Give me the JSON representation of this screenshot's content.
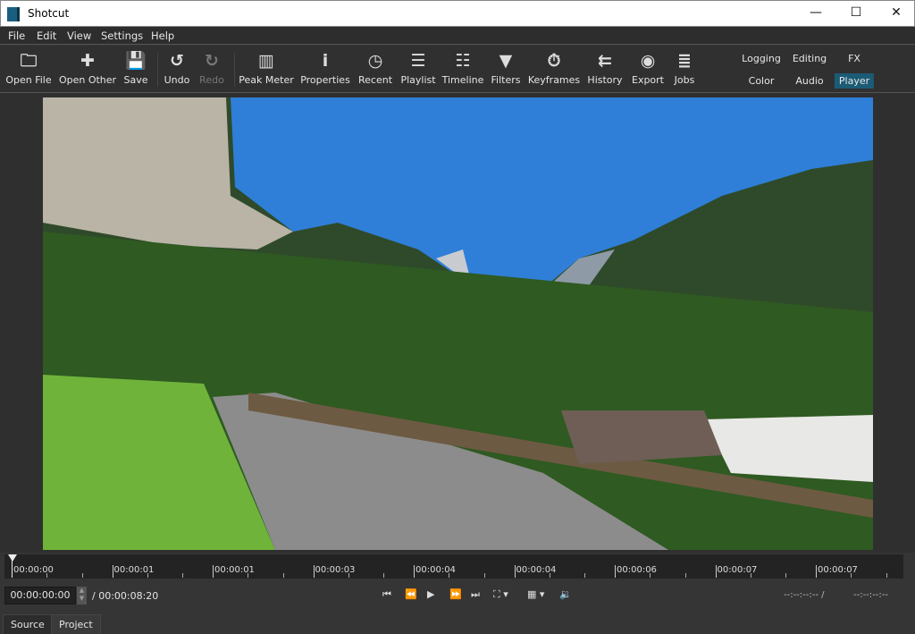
{
  "window": {
    "title": "Shotcut",
    "minimize": "—",
    "maximize": "☐",
    "close": "✕"
  },
  "menu": [
    "File",
    "Edit",
    "View",
    "Settings",
    "Help"
  ],
  "toolbar": [
    {
      "label": "Open File",
      "icon": "folder-icon",
      "glyph": "🗀"
    },
    {
      "label": "Open Other",
      "icon": "add-file-icon",
      "glyph": "✚"
    },
    {
      "label": "Save",
      "icon": "save-icon",
      "glyph": "💾"
    },
    {
      "label": "Undo",
      "icon": "undo-icon",
      "glyph": "↺"
    },
    {
      "label": "Redo",
      "icon": "redo-icon",
      "glyph": "↻",
      "disabled": true
    },
    {
      "label": "Peak Meter",
      "icon": "peak-meter-icon",
      "glyph": "▥"
    },
    {
      "label": "Properties",
      "icon": "info-icon",
      "glyph": "i"
    },
    {
      "label": "Recent",
      "icon": "clock-icon",
      "glyph": "◷"
    },
    {
      "label": "Playlist",
      "icon": "list-icon",
      "glyph": "☰"
    },
    {
      "label": "Timeline",
      "icon": "timeline-icon",
      "glyph": "☷"
    },
    {
      "label": "Filters",
      "icon": "filter-icon",
      "glyph": "▼"
    },
    {
      "label": "Keyframes",
      "icon": "stopwatch-icon",
      "glyph": "⏱"
    },
    {
      "label": "History",
      "icon": "history-icon",
      "glyph": "⇇"
    },
    {
      "label": "Export",
      "icon": "disc-icon",
      "glyph": "◉"
    },
    {
      "label": "Jobs",
      "icon": "database-icon",
      "glyph": "≣"
    }
  ],
  "layouts": {
    "row1": [
      "Logging",
      "Editing",
      "FX"
    ],
    "row2": [
      "Color",
      "Audio",
      "Player"
    ],
    "active": "Player",
    "active_color": "#1c5b75"
  },
  "ruler": [
    "00:00:00",
    "00:00:01",
    "00:00:01",
    "00:00:03",
    "00:00:04",
    "00:00:04",
    "00:00:06",
    "00:00:07",
    "00:00:07"
  ],
  "transport": {
    "timecode": "00:00:00:00",
    "duration": "/ 00:00:08:20",
    "in_point": "--:--:--:-- /",
    "out_point": "--:--:--:--",
    "buttons": [
      {
        "name": "skip-to-start",
        "glyph": "⏮"
      },
      {
        "name": "rewind",
        "glyph": "⏪"
      },
      {
        "name": "play",
        "glyph": "▶"
      },
      {
        "name": "fast-forward",
        "glyph": "⏩"
      },
      {
        "name": "skip-to-end",
        "glyph": "⏭"
      },
      {
        "name": "zoom",
        "glyph": "⛶ ▾"
      },
      {
        "name": "grid",
        "glyph": "▦ ▾"
      },
      {
        "name": "volume",
        "glyph": "🔉"
      }
    ]
  },
  "tabs": [
    "Source",
    "Project"
  ]
}
